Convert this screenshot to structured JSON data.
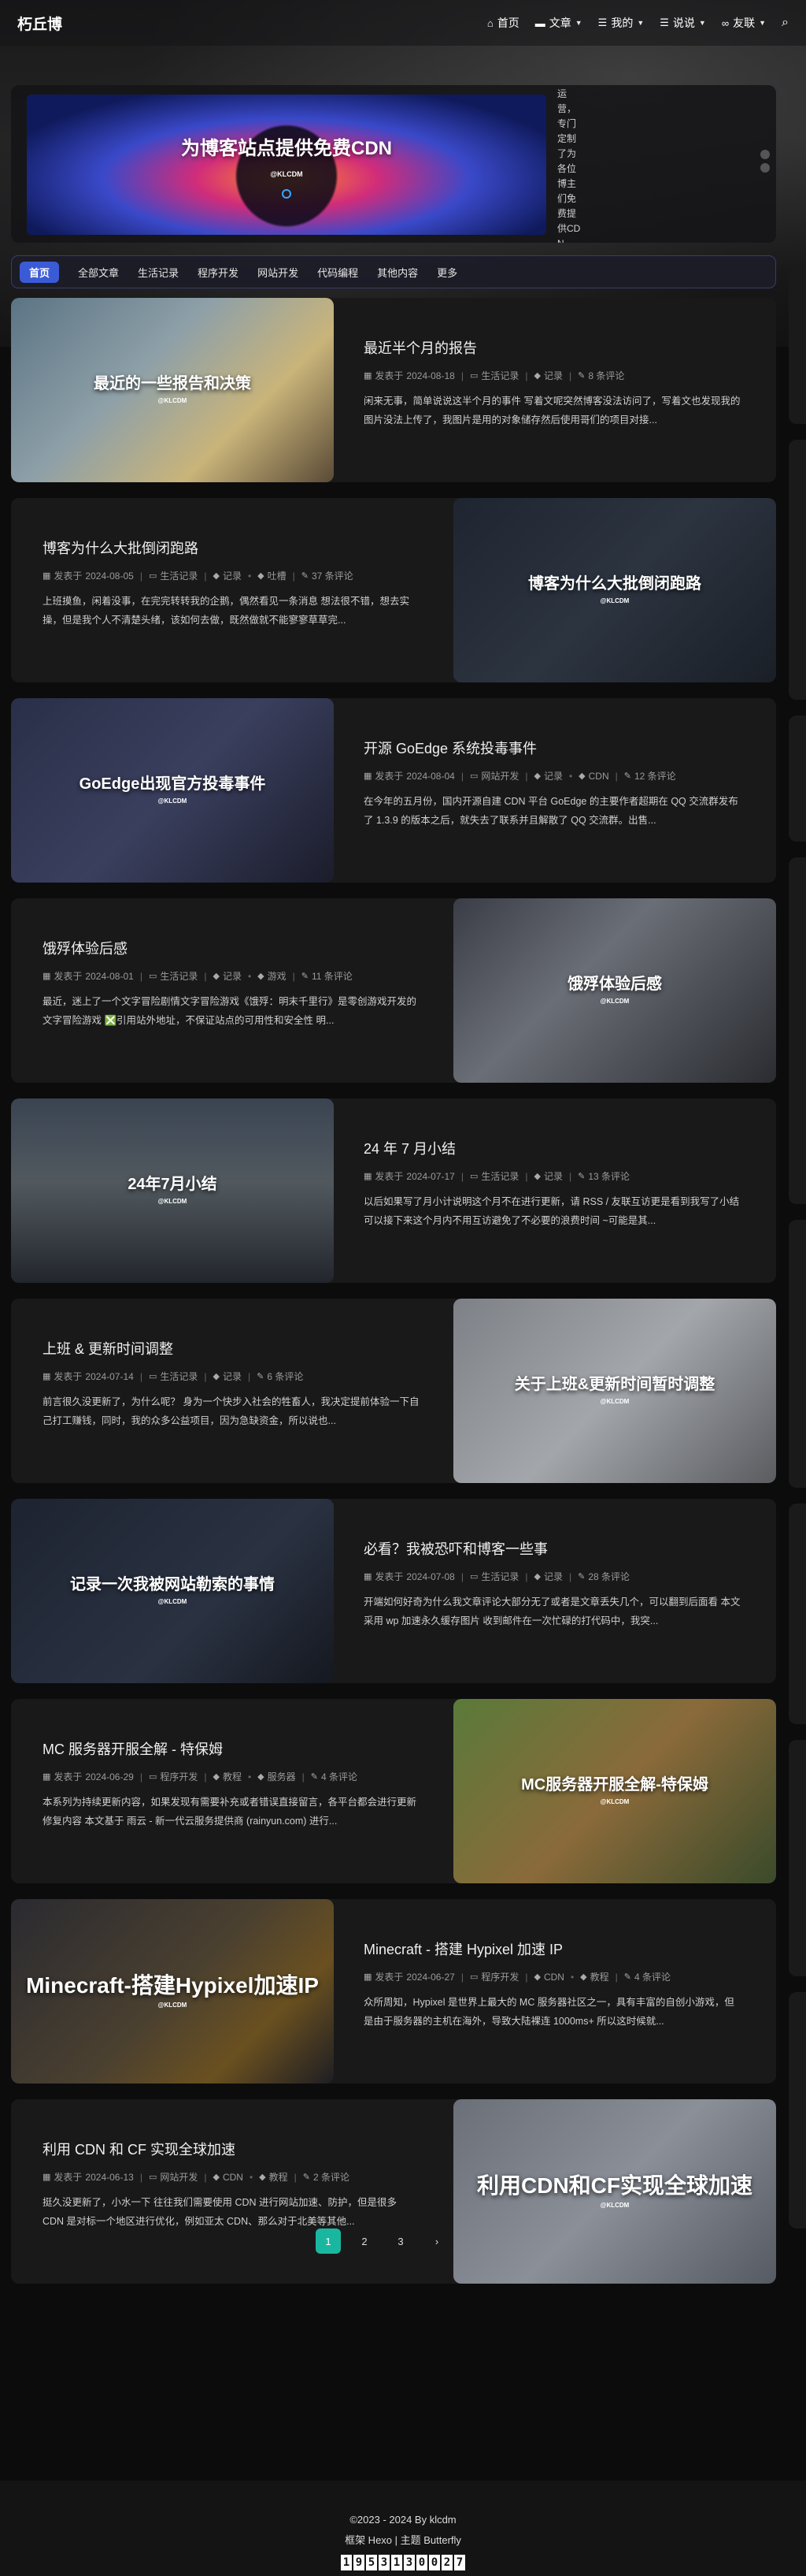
{
  "site": {
    "name": "朽丘博"
  },
  "nav": [
    {
      "icon": "home-icon",
      "glyph": "⌂",
      "label": "首页",
      "dropdown": false
    },
    {
      "icon": "folder-icon",
      "glyph": "▬",
      "label": "文章",
      "dropdown": true
    },
    {
      "icon": "list-icon",
      "glyph": "☰",
      "label": "我的",
      "dropdown": true
    },
    {
      "icon": "list-icon",
      "glyph": "☰",
      "label": "说说",
      "dropdown": true
    },
    {
      "icon": "link-icon",
      "glyph": "∞",
      "label": "友联",
      "dropdown": true
    }
  ],
  "banner": {
    "title": "为博客站点提供免费CDN",
    "mark": "@KLCDM",
    "text": "运营，专门定制了为各位博主们免费提供CDN"
  },
  "categories": [
    "首页",
    "全部文章",
    "生活记录",
    "程序开发",
    "网站开发",
    "代码编程",
    "其他内容",
    "更多"
  ],
  "posts": [
    {
      "layout": "left",
      "cover_title": "最近的一些报告和决策",
      "cover_bg": "linear-gradient(135deg,#5b7484 0%,#8ea0a8 40%,#c9b47a 70%,#5a4a36 100%)",
      "title": "最近半个月的报告",
      "date": "2024-08-18",
      "category": "生活记录",
      "tags": [
        "记录"
      ],
      "comments": "8 条评论",
      "excerpt": "闲来无事，简单说说这半个月的事件 写着文呢突然博客没法访问了，写着文也发现我的图片没法上传了，我图片是用的对象储存然后使用哥们的项目对接..."
    },
    {
      "layout": "right",
      "cover_title": "博客为什么大批倒闭跑路",
      "cover_bg": "linear-gradient(135deg,#1f2530 0%,#2c3440 50%,#1a1f27 100%)",
      "title": "博客为什么大批倒闭跑路",
      "date": "2024-08-05",
      "category": "生活记录",
      "tags": [
        "记录",
        "吐槽"
      ],
      "comments": "37 条评论",
      "excerpt": "上班摸鱼，闲着没事，在完完转转我的企鹅，偶然看见一条消息 想法很不错，想去实操，但是我个人不清楚头绪，该如何去做，既然做就不能寥寥草草完..."
    },
    {
      "layout": "left",
      "cover_title": "GoEdge出现官方投毒事件",
      "cover_bg": "linear-gradient(135deg,#2a2f48 0%,#3a3f5e 50%,#1b1d2b 100%)",
      "title": "开源 GoEdge 系统投毒事件",
      "date": "2024-08-04",
      "category": "网站开发",
      "tags": [
        "记录",
        "CDN"
      ],
      "comments": "12 条评论",
      "excerpt": "在今年的五月份，国内开源自建 CDN 平台 GoEdge 的主要作者超期在 QQ 交流群发布了 1.3.9 的版本之后，就失去了联系并且解散了 QQ 交流群。出售..."
    },
    {
      "layout": "right",
      "cover_title": "饿殍体验后感",
      "cover_bg": "linear-gradient(135deg,#3a3d45 0%,#6a6e76 40%,#2a2c31 100%)",
      "title": "饿殍体验后感",
      "date": "2024-08-01",
      "category": "生活记录",
      "tags": [
        "记录",
        "游戏"
      ],
      "comments": "11 条评论",
      "excerpt": "最近，迷上了一个文字冒险剧情文字冒险游戏《饿殍：明末千里行》是零创游戏开发的文字冒险游戏 ❎引用站外地址，不保证站点的可用性和安全性 明..."
    },
    {
      "layout": "left",
      "cover_title": "24年7月小结",
      "cover_bg": "linear-gradient(180deg,#3a4452 0%,#51595f 45%,#22262c 100%)",
      "title": "24 年 7 月小结",
      "date": "2024-07-17",
      "category": "生活记录",
      "tags": [
        "记录"
      ],
      "comments": "13 条评论",
      "excerpt": "以后如果写了月小计说明这个月不在进行更新，请 RSS / 友联互访更是看到我写了小结可以接下来这个月内不用互访避免了不必要的浪费时间 ~可能是其..."
    },
    {
      "layout": "right",
      "cover_title": "关于上班&更新时间暂时调整",
      "cover_bg": "linear-gradient(135deg,#7d8086 0%,#a3a6aa 50%,#5a5c60 100%)",
      "title": "上班 & 更新时间调整",
      "date": "2024-07-14",
      "category": "生活记录",
      "tags": [
        "记录"
      ],
      "comments": "6 条评论",
      "excerpt": "前言很久没更新了，为什么呢？ 身为一个快步入社会的牲畜人，我决定提前体验一下自己打工赚钱，同时，我的众多公益项目，因为急缺资金，所以说也..."
    },
    {
      "layout": "left",
      "cover_title": "记录一次我被网站勒索的事情",
      "cover_bg": "linear-gradient(135deg,#1d2330 0%,#2a3242 60%,#15181f 100%)",
      "title": "必看？我被恐吓和博客一些事",
      "date": "2024-07-08",
      "category": "生活记录",
      "tags": [
        "记录"
      ],
      "comments": "28 条评论",
      "excerpt": "开端如何好奇为什么我文章评论大部分无了或者是文章丢失几个，可以翻到后面看 本文采用 wp 加速永久缓存图片 收到邮件在一次忙碌的打代码中，我突..."
    },
    {
      "layout": "right",
      "cover_title": "MC服务器开服全解-特保姆",
      "cover_bg": "linear-gradient(135deg,#5a7a3a 0%,#8a6a3a 50%,#3a4a2a 100%)",
      "title": "MC 服务器开服全解 - 特保姆",
      "date": "2024-06-29",
      "category": "程序开发",
      "tags": [
        "教程",
        "服务器"
      ],
      "comments": "4 条评论",
      "excerpt": "本系列为持续更新内容，如果发现有需要补充或者错误直接留言，各平台都会进行更新修复内容 本文基于 雨云 - 新一代云服务提供商 (rainyun.com) 进行..."
    },
    {
      "layout": "left",
      "cover_title": "Minecraft-搭建Hypixel加速IP",
      "cover_bg": "linear-gradient(135deg,#2a2a30 0%,#4a4030 50%,#6a5020 75%,#1e1e22 100%)",
      "title": "Minecraft - 搭建 Hypixel 加速 IP",
      "date": "2024-06-27",
      "category": "程序开发",
      "tags": [
        "CDN",
        "教程"
      ],
      "comments": "4 条评论",
      "excerpt": "众所周知，Hypixel 是世界上最大的 MC 服务器社区之一，具有丰富的自创小游戏，但是由于服务器的主机在海外，导致大陆裸连 1000ms+ 所以这时候就..."
    },
    {
      "layout": "right",
      "cover_title": "利用CDN和CF实现全球加速",
      "cover_bg": "linear-gradient(135deg,#6a6f78 0%,#8a8f98 50%,#565a62 100%)",
      "title": "利用 CDN 和 CF 实现全球加速",
      "date": "2024-06-13",
      "category": "网站开发",
      "tags": [
        "CDN",
        "教程"
      ],
      "comments": "2 条评论",
      "excerpt": "挺久没更新了，小水一下 往往我们需要使用 CDN 进行网站加速、防护，但是很多 CDN 是对标一个地区进行优化，例如亚太 CDN、那么对于北美等其他..."
    }
  ],
  "meta_labels": {
    "posted": "发表于"
  },
  "pagination": [
    "1",
    "2",
    "3",
    "›"
  ],
  "footer": {
    "copyright": "©2023 - 2024 By klcdm",
    "powered": "框架 Hexo | 主题 Butterfly",
    "counter": [
      "1",
      "9",
      "5",
      "3",
      "1",
      "3",
      "0",
      "0",
      "2",
      "7"
    ]
  }
}
